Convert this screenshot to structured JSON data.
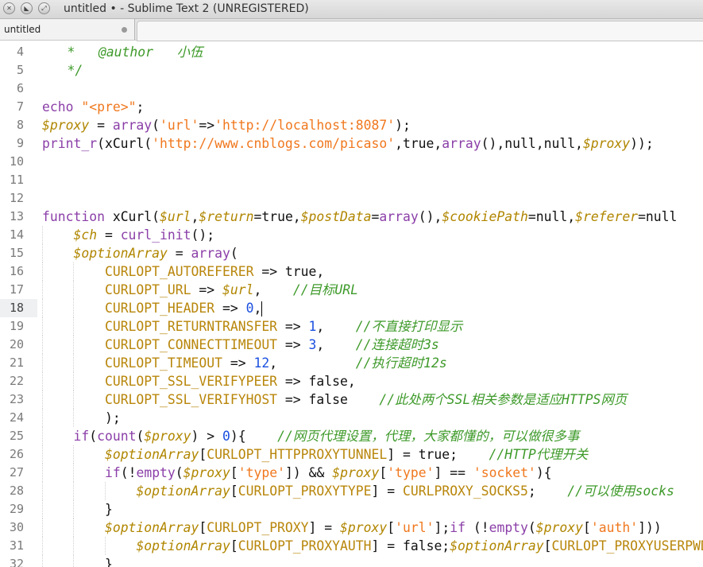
{
  "window": {
    "title": "untitled • - Sublime Text 2 (UNREGISTERED)",
    "buttons": [
      "close",
      "minimize",
      "maximize"
    ]
  },
  "tabs": [
    {
      "label": "untitled",
      "modified": true
    }
  ],
  "editor": {
    "current_line": 18,
    "lines": [
      {
        "n": "4",
        "indent": 0,
        "tokens": [
          [
            "co",
            "    *   @author   小伍"
          ]
        ]
      },
      {
        "n": "5",
        "indent": 0,
        "tokens": [
          [
            "co",
            "    */"
          ]
        ]
      },
      {
        "n": "6",
        "indent": 0,
        "tokens": []
      },
      {
        "n": "7",
        "indent": 1,
        "tokens": [
          [
            "kw",
            "echo"
          ],
          [
            "pl",
            " "
          ],
          [
            "st",
            "\"<pre>\""
          ],
          [
            "pl",
            ";"
          ]
        ]
      },
      {
        "n": "8",
        "indent": 1,
        "tokens": [
          [
            "va",
            "$proxy"
          ],
          [
            "pl",
            " = "
          ],
          [
            "kw",
            "array"
          ],
          [
            "pl",
            "("
          ],
          [
            "st",
            "'url'"
          ],
          [
            "pl",
            "=>"
          ],
          [
            "st",
            "'http://localhost:8087'"
          ],
          [
            "pl",
            ");"
          ]
        ]
      },
      {
        "n": "9",
        "indent": 1,
        "tokens": [
          [
            "kw",
            "print_r"
          ],
          [
            "pl",
            "(xCurl("
          ],
          [
            "st",
            "'http://www.cnblogs.com/picaso'"
          ],
          [
            "pl",
            ",true,"
          ],
          [
            "kw",
            "array"
          ],
          [
            "pl",
            "(),null,null,"
          ],
          [
            "va",
            "$proxy"
          ],
          [
            "pl",
            "));"
          ]
        ]
      },
      {
        "n": "10",
        "indent": 0,
        "tokens": []
      },
      {
        "n": "11",
        "indent": 0,
        "tokens": []
      },
      {
        "n": "12",
        "indent": 0,
        "tokens": []
      },
      {
        "n": "13",
        "indent": 1,
        "tokens": [
          [
            "kw",
            "function"
          ],
          [
            "pl",
            " xCurl("
          ],
          [
            "va",
            "$url"
          ],
          [
            "pl",
            ","
          ],
          [
            "va",
            "$return"
          ],
          [
            "pl",
            "=true,"
          ],
          [
            "va",
            "$postData"
          ],
          [
            "pl",
            "="
          ],
          [
            "kw",
            "array"
          ],
          [
            "pl",
            "(),"
          ],
          [
            "va",
            "$cookiePath"
          ],
          [
            "pl",
            "=null,"
          ],
          [
            "va",
            "$referer"
          ],
          [
            "pl",
            "=null"
          ]
        ]
      },
      {
        "n": "14",
        "indent": 2,
        "tokens": [
          [
            "va",
            "$ch"
          ],
          [
            "pl",
            " = "
          ],
          [
            "kw",
            "curl_init"
          ],
          [
            "pl",
            "();"
          ]
        ]
      },
      {
        "n": "15",
        "indent": 2,
        "tokens": [
          [
            "va",
            "$optionArray"
          ],
          [
            "pl",
            " = "
          ],
          [
            "kw",
            "array"
          ],
          [
            "pl",
            "("
          ]
        ]
      },
      {
        "n": "16",
        "indent": 3,
        "tokens": [
          [
            "cn",
            "CURLOPT_AUTOREFERER"
          ],
          [
            "pl",
            " => true,"
          ]
        ]
      },
      {
        "n": "17",
        "indent": 3,
        "tokens": [
          [
            "cn",
            "CURLOPT_URL"
          ],
          [
            "pl",
            " => "
          ],
          [
            "va",
            "$url"
          ],
          [
            "pl",
            ",    "
          ],
          [
            "co",
            "//目标URL"
          ]
        ]
      },
      {
        "n": "18",
        "indent": 3,
        "tokens": [
          [
            "cn",
            "CURLOPT_HEADER"
          ],
          [
            "pl",
            " => "
          ],
          [
            "nu",
            "0"
          ],
          [
            "pl",
            ","
          ],
          [
            "caret",
            ""
          ]
        ]
      },
      {
        "n": "19",
        "indent": 3,
        "tokens": [
          [
            "cn",
            "CURLOPT_RETURNTRANSFER"
          ],
          [
            "pl",
            " => "
          ],
          [
            "nu",
            "1"
          ],
          [
            "pl",
            ",    "
          ],
          [
            "co",
            "//不直接打印显示"
          ]
        ]
      },
      {
        "n": "20",
        "indent": 3,
        "tokens": [
          [
            "cn",
            "CURLOPT_CONNECTTIMEOUT"
          ],
          [
            "pl",
            " => "
          ],
          [
            "nu",
            "3"
          ],
          [
            "pl",
            ",    "
          ],
          [
            "co",
            "//连接超时3s"
          ]
        ]
      },
      {
        "n": "21",
        "indent": 3,
        "tokens": [
          [
            "cn",
            "CURLOPT_TIMEOUT"
          ],
          [
            "pl",
            " => "
          ],
          [
            "nu",
            "12"
          ],
          [
            "pl",
            ",          "
          ],
          [
            "co",
            "//执行超时12s"
          ]
        ]
      },
      {
        "n": "22",
        "indent": 3,
        "tokens": [
          [
            "cn",
            "CURLOPT_SSL_VERIFYPEER"
          ],
          [
            "pl",
            " => false,"
          ]
        ]
      },
      {
        "n": "23",
        "indent": 3,
        "tokens": [
          [
            "cn",
            "CURLOPT_SSL_VERIFYHOST"
          ],
          [
            "pl",
            " => false    "
          ],
          [
            "co",
            "//此处两个SSL相关参数是适应HTTPS网页"
          ]
        ]
      },
      {
        "n": "24",
        "indent": 3,
        "tokens": [
          [
            "pl",
            ");"
          ]
        ]
      },
      {
        "n": "25",
        "indent": 2,
        "tokens": [
          [
            "kw",
            "if"
          ],
          [
            "pl",
            "("
          ],
          [
            "kw",
            "count"
          ],
          [
            "pl",
            "("
          ],
          [
            "va",
            "$proxy"
          ],
          [
            "pl",
            ") > "
          ],
          [
            "nu",
            "0"
          ],
          [
            "pl",
            "){    "
          ],
          [
            "co",
            "//网页代理设置，代理，大家都懂的，可以做很多事"
          ]
        ]
      },
      {
        "n": "26",
        "indent": 3,
        "tokens": [
          [
            "va",
            "$optionArray"
          ],
          [
            "pl",
            "["
          ],
          [
            "cn",
            "CURLOPT_HTTPPROXYTUNNEL"
          ],
          [
            "pl",
            "] = true;    "
          ],
          [
            "co",
            "//HTTP代理开关"
          ]
        ]
      },
      {
        "n": "27",
        "indent": 3,
        "tokens": [
          [
            "kw",
            "if"
          ],
          [
            "pl",
            "(!"
          ],
          [
            "kw",
            "empty"
          ],
          [
            "pl",
            "("
          ],
          [
            "va",
            "$proxy"
          ],
          [
            "pl",
            "["
          ],
          [
            "st",
            "'type'"
          ],
          [
            "pl",
            "]) && "
          ],
          [
            "va",
            "$proxy"
          ],
          [
            "pl",
            "["
          ],
          [
            "st",
            "'type'"
          ],
          [
            "pl",
            "] == "
          ],
          [
            "st",
            "'socket'"
          ],
          [
            "pl",
            "){"
          ]
        ]
      },
      {
        "n": "28",
        "indent": 4,
        "tokens": [
          [
            "va",
            "$optionArray"
          ],
          [
            "pl",
            "["
          ],
          [
            "cn",
            "CURLOPT_PROXYTYPE"
          ],
          [
            "pl",
            "] = "
          ],
          [
            "cn",
            "CURLPROXY_SOCKS5"
          ],
          [
            "pl",
            ";    "
          ],
          [
            "co",
            "//可以使用socks"
          ]
        ]
      },
      {
        "n": "29",
        "indent": 3,
        "tokens": [
          [
            "pl",
            "}"
          ]
        ]
      },
      {
        "n": "30",
        "indent": 3,
        "tokens": [
          [
            "va",
            "$optionArray"
          ],
          [
            "pl",
            "["
          ],
          [
            "cn",
            "CURLOPT_PROXY"
          ],
          [
            "pl",
            "] = "
          ],
          [
            "va",
            "$proxy"
          ],
          [
            "pl",
            "["
          ],
          [
            "st",
            "'url'"
          ],
          [
            "pl",
            "];"
          ],
          [
            "kw",
            "if"
          ],
          [
            "pl",
            " (!"
          ],
          [
            "kw",
            "empty"
          ],
          [
            "pl",
            "("
          ],
          [
            "va",
            "$proxy"
          ],
          [
            "pl",
            "["
          ],
          [
            "st",
            "'auth'"
          ],
          [
            "pl",
            "]))"
          ]
        ]
      },
      {
        "n": "31",
        "indent": 4,
        "tokens": [
          [
            "va",
            "$optionArray"
          ],
          [
            "pl",
            "["
          ],
          [
            "cn",
            "CURLOPT_PROXYAUTH"
          ],
          [
            "pl",
            "] = false;"
          ],
          [
            "va",
            "$optionArray"
          ],
          [
            "pl",
            "["
          ],
          [
            "cn",
            "CURLOPT_PROXYUSERPWD"
          ]
        ]
      },
      {
        "n": "32",
        "indent": 3,
        "tokens": [
          [
            "pl",
            "}"
          ]
        ]
      }
    ]
  }
}
